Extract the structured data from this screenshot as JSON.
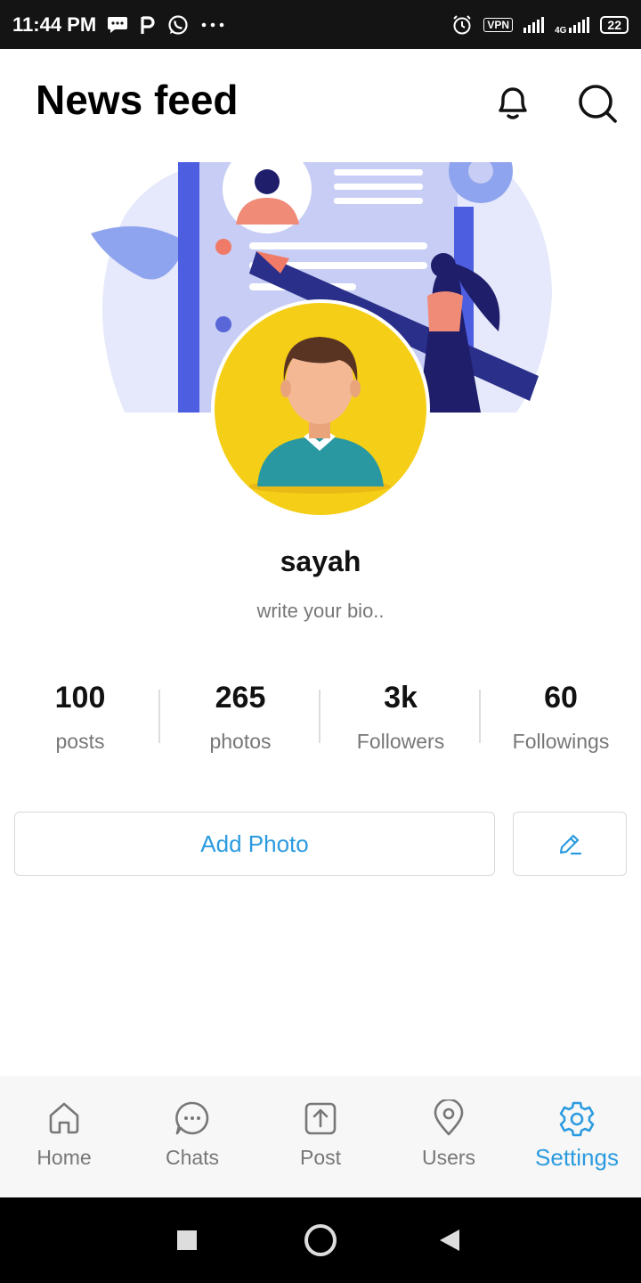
{
  "status_bar": {
    "time": "11:44 PM",
    "vpn": "VPN",
    "network": "4G",
    "battery": "22"
  },
  "header": {
    "title": "News feed",
    "notification_icon": "bell-icon",
    "search_icon": "search-icon"
  },
  "profile": {
    "username": "sayah",
    "bio_placeholder": "write your bio.."
  },
  "stats": [
    {
      "value": "100",
      "label": "posts"
    },
    {
      "value": "265",
      "label": "photos"
    },
    {
      "value": "3k",
      "label": "Followers"
    },
    {
      "value": "60",
      "label": "Followings"
    }
  ],
  "actions": {
    "add_photo_label": "Add Photo",
    "edit_icon": "pencil-icon"
  },
  "bottom_nav": [
    {
      "label": "Home",
      "icon": "home-icon",
      "active": false
    },
    {
      "label": "Chats",
      "icon": "chat-bubble-icon",
      "active": false
    },
    {
      "label": "Post",
      "icon": "upload-icon",
      "active": false
    },
    {
      "label": "Users",
      "icon": "location-pin-icon",
      "active": false
    },
    {
      "label": "Settings",
      "icon": "gear-icon",
      "active": true
    }
  ],
  "colors": {
    "accent": "#2b9be0",
    "status_bar": "#141414",
    "avatar_bg": "#f5cf17"
  }
}
